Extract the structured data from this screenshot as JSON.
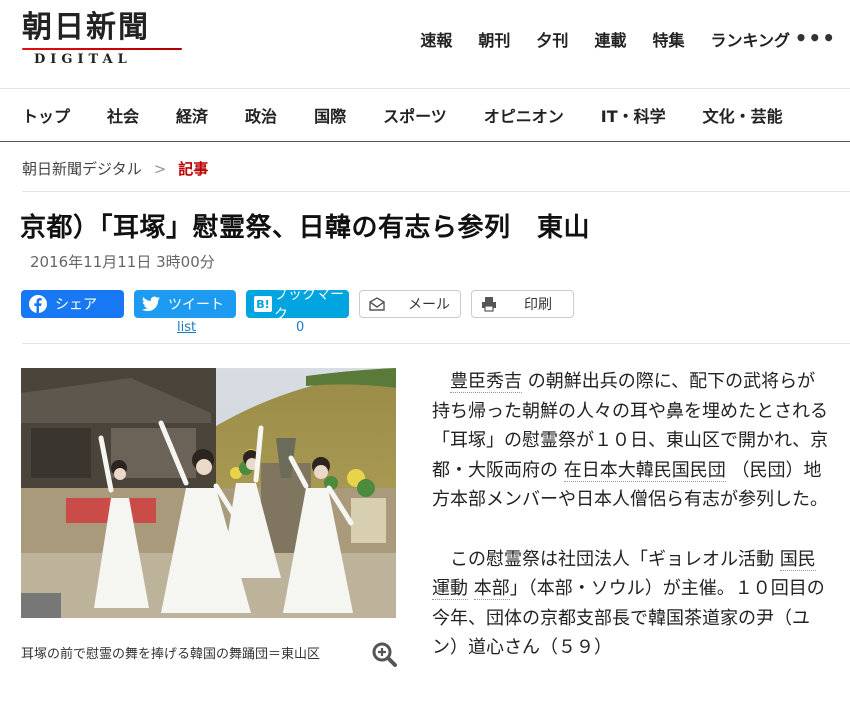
{
  "header": {
    "logo_main": "朝日新聞",
    "logo_sub": "DIGITAL",
    "nav": [
      "速報",
      "朝刊",
      "夕刊",
      "連載",
      "特集",
      "ランキング"
    ],
    "more": "•••"
  },
  "categories": [
    "トップ",
    "社会",
    "経済",
    "政治",
    "国際",
    "スポーツ",
    "オピニオン",
    "IT・科学",
    "文化・芸能"
  ],
  "breadcrumb": {
    "home": "朝日新聞デジタル",
    "sep": ">",
    "current": "記事"
  },
  "article": {
    "title": "京都）「耳塚」慰霊祭、日韓の有志ら参列　東山",
    "date": "2016年11月11日 3時00分"
  },
  "share": {
    "facebook": "シェア",
    "twitter": "ツイート",
    "twitter_count": "list",
    "hatena": "ブックマーク",
    "hatena_count": "0",
    "mail": "メール",
    "print": "印刷"
  },
  "photo": {
    "caption": "耳塚の前で慰霊の舞を捧げる韓国の舞踊団＝東山区"
  },
  "body": {
    "p1": {
      "kw1": "豊臣秀吉",
      "t1": " の朝鮮出兵の際に、配下の武将らが持ち帰った朝鮮の人々の耳や鼻を埋めたとされる「耳塚」の慰霊祭が１０日、東山区で開かれ、京都・大阪両府の ",
      "kw2": "在日本大韓民国民団",
      "t2": " （民団）地方本部メンバーや日本人僧侶ら有志が参列した。"
    },
    "p2": {
      "t1": "この慰霊祭は社団法人「ギョレオル活動 ",
      "kw1": "国民運動",
      "t2": " ",
      "kw2": "本部",
      "t3": "」（本部・ソウル）が主催。１０回目の今年、団体の京都支部長で韓国茶道家の尹（ユン）道心さん（５９）"
    }
  }
}
